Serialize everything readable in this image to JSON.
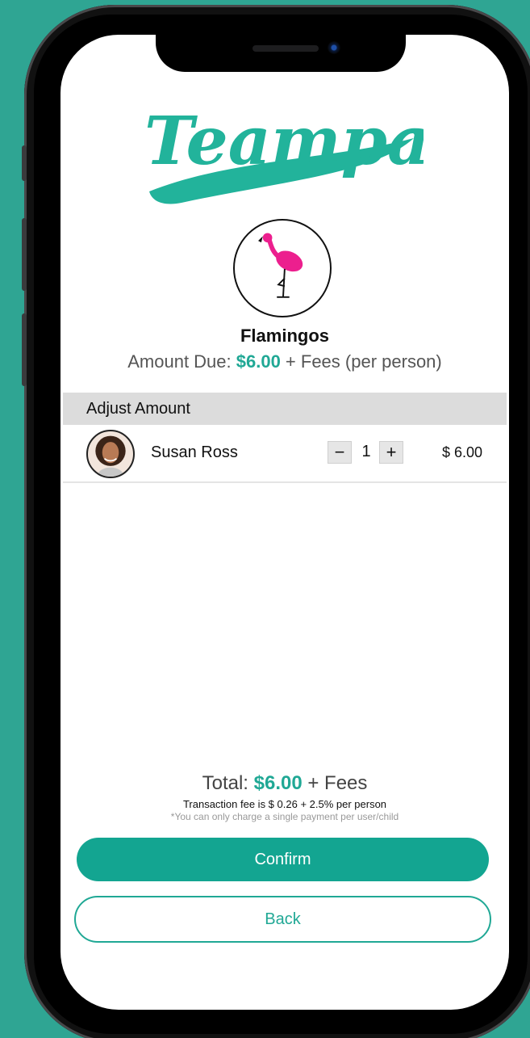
{
  "app": {
    "logo_text": "Teampay"
  },
  "team": {
    "name": "Flamingos",
    "avatar_icon": "flamingo-icon"
  },
  "amount_due": {
    "label": "Amount Due: ",
    "value": "$6.00",
    "suffix": " + Fees (per person)"
  },
  "adjust": {
    "header": "Adjust Amount",
    "rows": [
      {
        "name": "Susan Ross",
        "minus": "−",
        "quantity": "1",
        "plus": "+",
        "amount": "$ 6.00"
      }
    ]
  },
  "summary": {
    "total_label": "Total: ",
    "total_value": "$6.00",
    "total_suffix": " + Fees",
    "fee_note": "Transaction fee is $ 0.26 + 2.5% per person",
    "disclaimer": "*You can only charge a single payment per user/child"
  },
  "actions": {
    "confirm": "Confirm",
    "back": "Back"
  },
  "colors": {
    "accent": "#20a895",
    "background": "#2fa593",
    "brand_pink": "#ec1f8e"
  }
}
